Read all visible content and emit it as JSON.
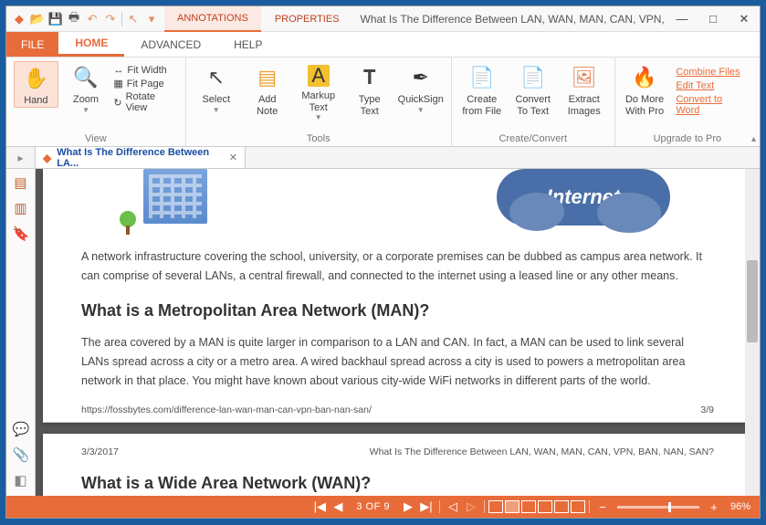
{
  "window": {
    "title": "What Is The Difference Between LAN, WAN, MAN, CAN, VPN, BAN, ...",
    "min": "—",
    "max": "□",
    "close": "✕"
  },
  "topTabs": {
    "annotations": "ANNOTATIONS",
    "properties": "PROPERTIES"
  },
  "menu": {
    "file": "FILE",
    "home": "HOME",
    "advanced": "ADVANCED",
    "help": "HELP"
  },
  "ribbon": {
    "hand": "Hand",
    "zoom": "Zoom",
    "fitWidth": "Fit Width",
    "fitPage": "Fit Page",
    "rotate": "Rotate View",
    "viewGroup": "View",
    "select": "Select",
    "addNote": "Add\nNote",
    "markup": "Markup\nText",
    "typeText": "Type\nText",
    "quicksign": "QuickSign",
    "toolsGroup": "Tools",
    "createFromFile": "Create\nfrom File",
    "convertToText": "Convert\nTo Text",
    "extractImages": "Extract\nImages",
    "createGroup": "Create/Convert",
    "doMore": "Do More\nWith Pro",
    "combine": "Combine Files",
    "editText": "Edit Text",
    "convertWord": "Convert to Word",
    "upgradeGroup": "Upgrade to Pro"
  },
  "docTab": {
    "title": "What Is The Difference Between LA..."
  },
  "document": {
    "cloud": "Internet",
    "para1": "A network infrastructure covering the school, university, or a corporate premises can be dubbed as campus area network. It can comprise of several LANs, a central firewall, and connected to the internet using a leased line or any other means.",
    "h2a": "What is a Metropolitan Area Network (MAN)?",
    "para2": "The area covered by a MAN is quite larger in comparison to a LAN and CAN. In fact, a MAN can be used to link several LANs spread across a city or a metro area. A wired backhaul spread across a city is used to powers a metropolitan area network in that place. You might have known about various city-wide WiFi networks in different parts of the world.",
    "footerUrl": "https://fossbytes.com/difference-lan-wan-man-can-vpn-ban-nan-san/",
    "footerPage": "3/9",
    "headerDate": "3/3/2017",
    "headerTitle": "What Is The Difference Between LAN, WAN, MAN, CAN, VPN, BAN, NAN, SAN?",
    "h2b": "What is a Wide Area Network (WAN)?"
  },
  "status": {
    "page": "3 OF 9",
    "zoom": "96%"
  }
}
